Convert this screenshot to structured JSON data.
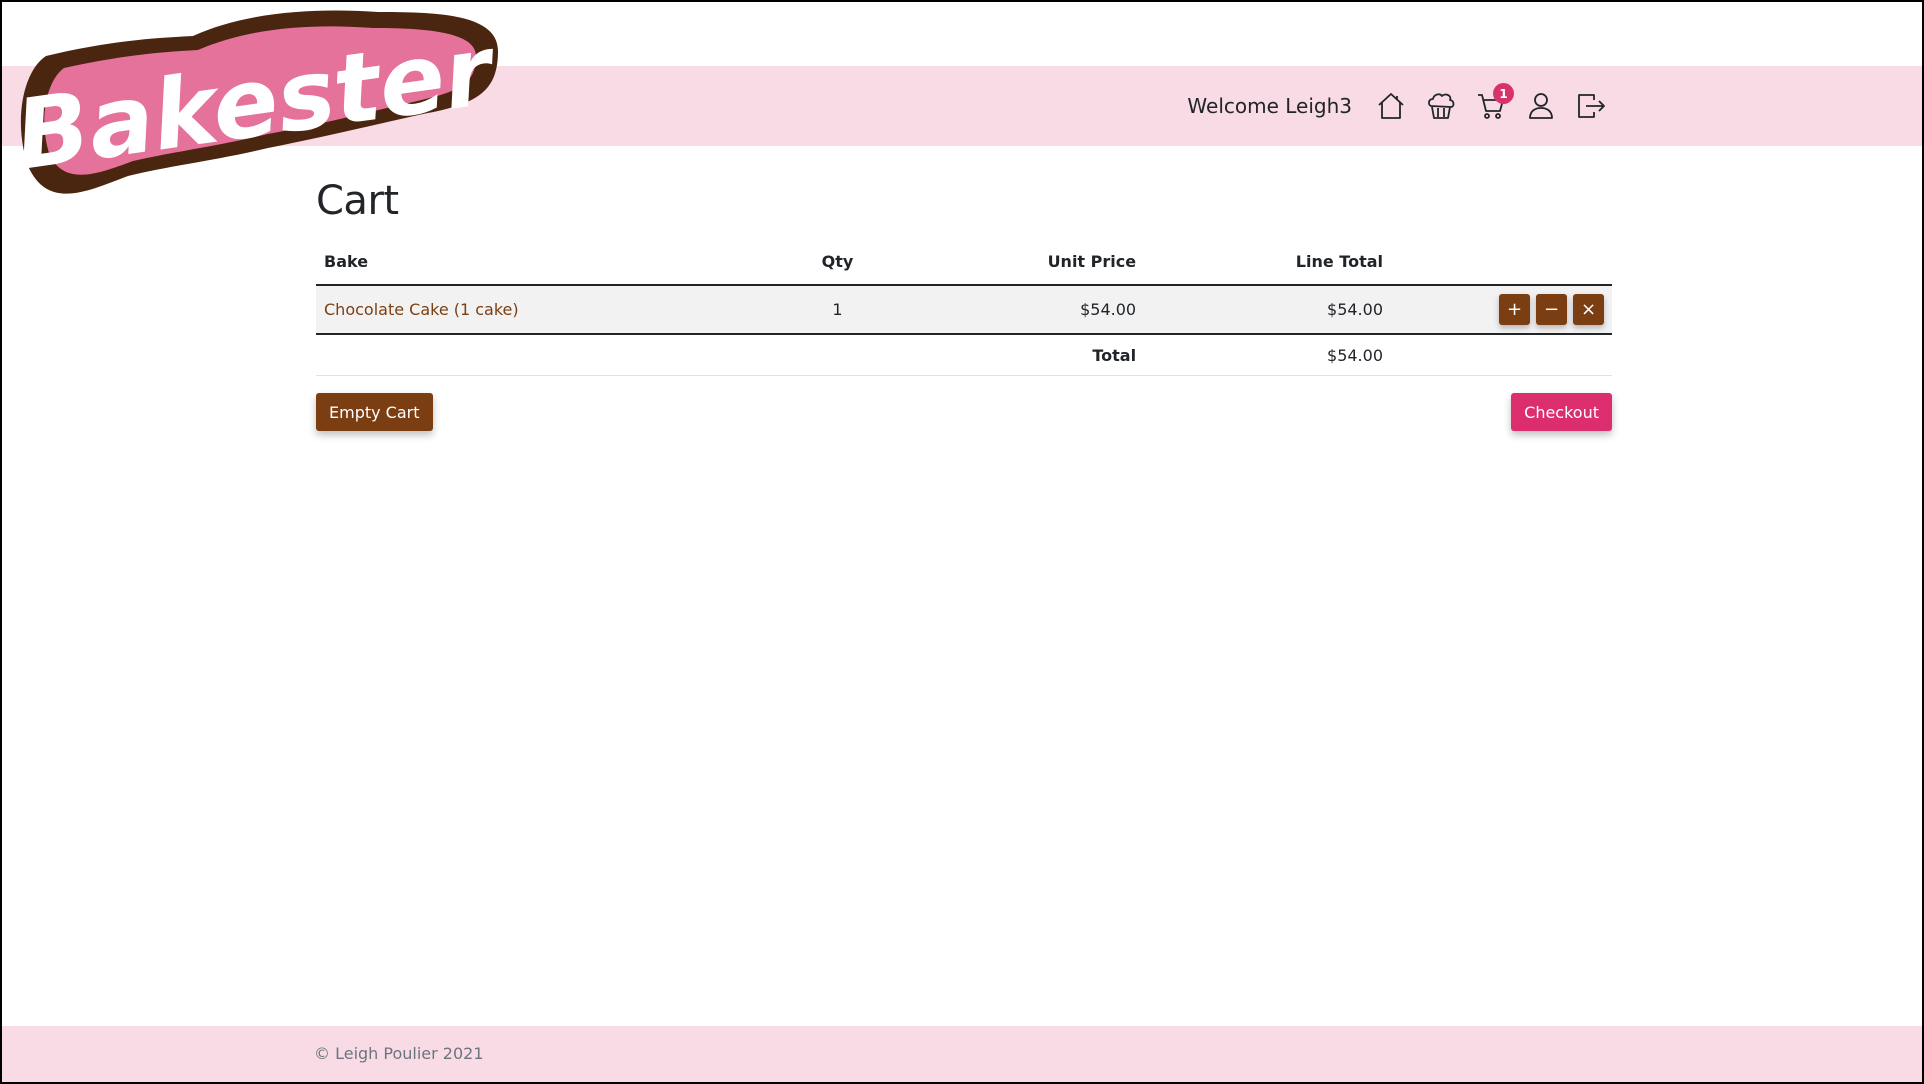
{
  "brand": {
    "logo_text": "Bakester"
  },
  "header": {
    "welcome": "Welcome Leigh3",
    "icons": [
      "home-icon",
      "cupcake-icon",
      "cart-icon",
      "user-icon",
      "logout-icon"
    ],
    "cart_count": "1"
  },
  "page": {
    "title": "Cart"
  },
  "table": {
    "headers": {
      "bake": "Bake",
      "qty": "Qty",
      "unit_price": "Unit Price",
      "line_total": "Line Total"
    },
    "rows": [
      {
        "bake": "Chocolate Cake (1 cake)",
        "qty": "1",
        "unit_price": "$54.00",
        "line_total": "$54.00",
        "actions": {
          "plus": "+",
          "minus": "−",
          "remove": "×"
        }
      }
    ],
    "total_label": "Total",
    "total_value": "$54.00"
  },
  "buttons": {
    "empty_cart": "Empty Cart",
    "checkout": "Checkout"
  },
  "footer": {
    "copyright": "© Leigh Poulier 2021"
  },
  "colors": {
    "pink_band": "#f8dbe4",
    "brown": "#7b3d12",
    "pink_accent": "#dc2d6e",
    "logo_pink": "#e5729b",
    "logo_brown": "#4a250f"
  }
}
